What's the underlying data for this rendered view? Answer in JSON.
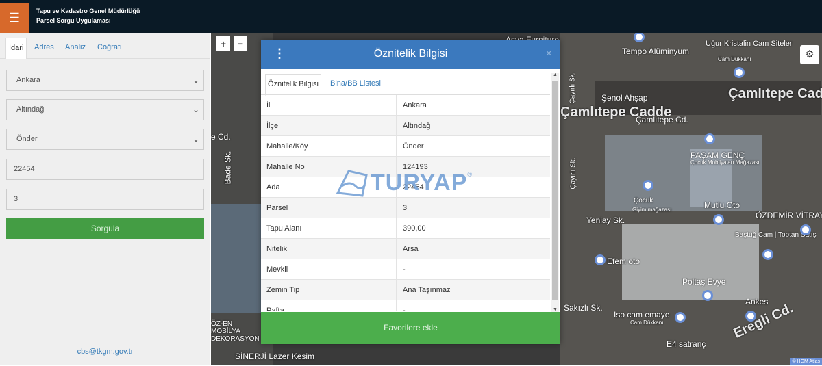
{
  "header": {
    "line1": "Tapu ve Kadastro Genel Müdürlüğü",
    "line2": "Parsel Sorgu Uygulaması",
    "menu_icon": "hamburger-icon",
    "accent": "#d7692b"
  },
  "left_panel": {
    "tabs": [
      "İdari",
      "Adres",
      "Analiz",
      "Coğrafi"
    ],
    "fields": {
      "il": "Ankara",
      "ilce": "Altındağ",
      "mahalle": "Önder",
      "ada": "22454",
      "parsel": "3"
    },
    "submit_label": "Sorgula",
    "contact_email": "cbs@tkgm.gov.tr"
  },
  "map": {
    "zoom_in": "+",
    "zoom_out": "−",
    "labels": {
      "street1": "Çamlıtepe Cadde",
      "street2": "Çamlıtepe Cd.",
      "street3": "Yeniay Sk.",
      "street4": "Çayırlı Sk.",
      "street5": "Çayırlı Sk.",
      "street6": "Sakızlı Sk.",
      "street7": "Eregli Cd.",
      "street8": "Bade Sk.",
      "street9": "e Cd.",
      "poi1": "Tempo Alüminyum",
      "poi2": "Uğur Kristalin Cam Siteler",
      "poi2_sub": "Cam Dükkanı",
      "poi3": "Şenol Ahşap",
      "poi4": "PAŞAM GENÇ",
      "poi4_sub": "Çocuk Mobilyaları Mağazası",
      "poi5": "Çocuk",
      "poi5_sub": "Giyim mağazası",
      "poi6": "Mutlu Oto",
      "poi7": "ÖZDEMİR VİTRAY",
      "poi8": "Baştuğ Cam | Toptan Satış",
      "poi9": "Efem oto",
      "poi10": "Poltaş Evye",
      "poi11": "Iso cam emaye",
      "poi11_sub": "Cam Dükkanı",
      "poi12": "Ankes",
      "poi13": "E4 satranç",
      "poi14": "ÖZ-EN MOBİLYA DEKORASYON",
      "poi15": "SİNERJİ Lazer Kesim",
      "poi16": "Asya Furniture",
      "attribution": "© HGM Atlas"
    },
    "settings_icon": "gear-icon"
  },
  "modal": {
    "title": "Öznitelik Bilgisi",
    "close": "×",
    "tabs": [
      "Öznitelik Bilgisi",
      "Bina/BB Listesi"
    ],
    "rows": [
      {
        "key": "İl",
        "value": "Ankara"
      },
      {
        "key": "İlçe",
        "value": "Altındağ"
      },
      {
        "key": "Mahalle/Köy",
        "value": "Önder"
      },
      {
        "key": "Mahalle No",
        "value": "124193"
      },
      {
        "key": "Ada",
        "value": "22454"
      },
      {
        "key": "Parsel",
        "value": "3"
      },
      {
        "key": "Tapu Alanı",
        "value": "390,00"
      },
      {
        "key": "Nitelik",
        "value": "Arsa"
      },
      {
        "key": "Mevkii",
        "value": "-"
      },
      {
        "key": "Zemin Tip",
        "value": "Ana Taşınmaz"
      },
      {
        "key": "Pafta",
        "value": "-"
      }
    ],
    "favorite_label": "Favorilere ekle"
  },
  "watermark": {
    "text": "TURYAP",
    "reg": "®"
  }
}
